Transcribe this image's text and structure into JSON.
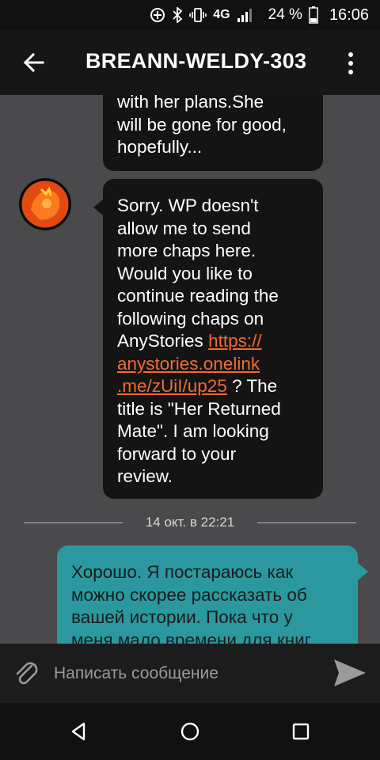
{
  "status_bar": {
    "network_label": "4G",
    "battery_percent": "24 %",
    "time": "16:06",
    "icons": [
      "data-saver-icon",
      "bluetooth-icon",
      "vibrate-icon",
      "signal-icon",
      "battery-icon"
    ]
  },
  "app_bar": {
    "title": "BREANN-WELDY-303",
    "back_icon": "arrow-back-icon",
    "menu_icon": "more-vert-icon"
  },
  "messages": [
    {
      "side": "incoming",
      "lines": [
        "with her plans.She",
        "will be gone for good,",
        "hopefully..."
      ]
    },
    {
      "side": "incoming",
      "text_before": "Sorry. WP doesn't allow me to send more chaps here. Would you like to continue reading the following chaps on AnyStories ",
      "link_text": "https://anystories.onelink.me/zUiI/up25",
      "link_lines": [
        "https://",
        "anystories.onelink",
        ".me/zUiI/up25"
      ],
      "text_after": " ? The title is \"Her Returned Mate\". I am looking forward to your review.",
      "lines": [
        "Sorry. WP doesn't",
        "allow me to send",
        "more chaps here.",
        "Would you like to",
        "continue reading the",
        "following chaps on",
        "AnyStories ",
        " ? The",
        "title is \"Her Returned",
        "Mate\". I am looking",
        "forward to your",
        "review."
      ]
    },
    {
      "side": "outgoing",
      "lines": [
        "Хорошо. Я постараюсь как",
        "можно скорее рассказать об",
        "вашей истории. Пока что у",
        "меня мало времени для книг"
      ]
    }
  ],
  "date_divider": "14 окт. в 22:21",
  "composer": {
    "placeholder": "Написать сообщение",
    "attach_icon": "paperclip-icon",
    "send_icon": "send-icon"
  },
  "nav_bar": {
    "icons": [
      "back-triangle-icon",
      "home-circle-icon",
      "recents-square-icon"
    ]
  },
  "colors": {
    "background": "#4a494c",
    "incoming_bubble": "#141414",
    "outgoing_bubble": "#2a989e",
    "link": "#f26a33"
  }
}
